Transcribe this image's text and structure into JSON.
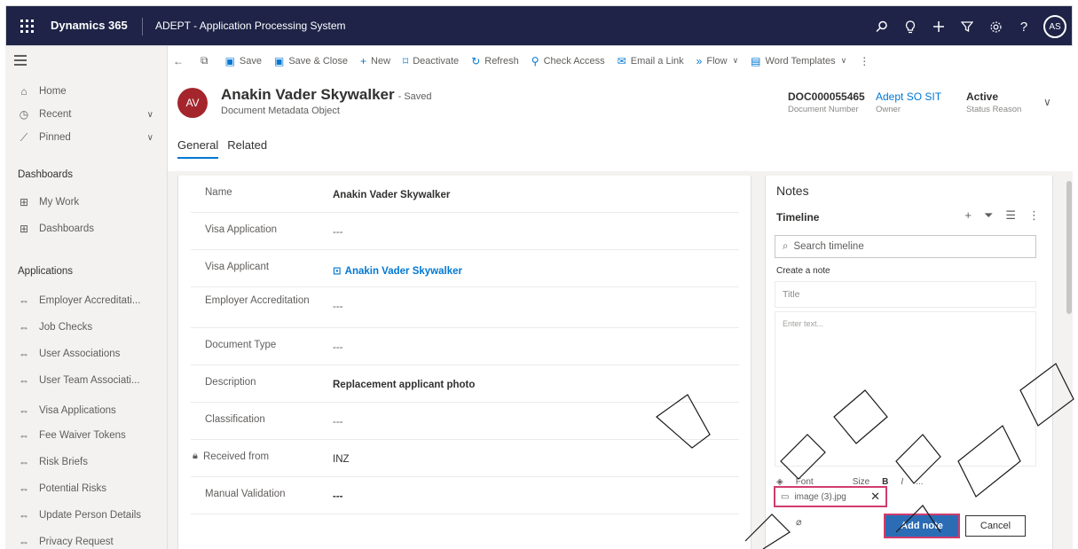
{
  "topbar": {
    "brand": "Dynamics 365",
    "app_name": "ADEPT - Application Processing System",
    "user_initials": "AS"
  },
  "sidebar": {
    "home": "Home",
    "recent": "Recent",
    "pinned": "Pinned",
    "dashboards_heading": "Dashboards",
    "my_work": "My Work",
    "dashboards": "Dashboards",
    "applications_heading": "Applications",
    "items": [
      "Employer Accreditati...",
      "Job Checks",
      "User Associations",
      "User Team Associati...",
      "Visa Applications",
      "Fee Waiver Tokens",
      "Risk Briefs",
      "Potential Risks",
      "Update Person Details",
      "Privacy Request"
    ]
  },
  "commands": {
    "save": "Save",
    "save_close": "Save & Close",
    "new": "New",
    "deactivate": "Deactivate",
    "refresh": "Refresh",
    "check_access": "Check Access",
    "email_link": "Email a Link",
    "flow": "Flow",
    "word_templates": "Word Templates"
  },
  "record": {
    "initials": "AV",
    "title": "Anakin Vader Skywalker",
    "saved": "- Saved",
    "entity": "Document Metadata Object",
    "doc_number": "DOC000055465",
    "doc_number_label": "Document Number",
    "owner": "Adept SO SIT",
    "owner_label": "Owner",
    "status": "Active",
    "status_label": "Status Reason"
  },
  "tabs": {
    "general": "General",
    "related": "Related"
  },
  "form": {
    "name_label": "Name",
    "name_value": "Anakin Vader Skywalker",
    "visa_app_label": "Visa Application",
    "visa_app_value": "---",
    "visa_applicant_label": "Visa Applicant",
    "visa_applicant_value": "Anakin Vader Skywalker",
    "employer_label": "Employer Accreditation",
    "employer_value": "---",
    "doc_type_label": "Document Type",
    "doc_type_value": "---",
    "description_label": "Description",
    "description_value": "Replacement applicant photo",
    "classification_label": "Classification",
    "classification_value": "---",
    "received_label": "Received from",
    "received_value": "INZ",
    "manual_label": "Manual Validation",
    "manual_value": "---"
  },
  "notes": {
    "title": "Notes",
    "timeline": "Timeline",
    "search_placeholder": "Search timeline",
    "create_note": "Create a note",
    "title_placeholder": "Title",
    "body_placeholder": "Enter text...",
    "font": "Font",
    "size": "Size",
    "bold": "B",
    "italic": "I",
    "more": "...",
    "attachment": "image (3).jpg",
    "add_note": "Add note",
    "cancel": "Cancel"
  },
  "colors": {
    "topbar": "#1e2347",
    "accent": "#0078d4",
    "record_avatar": "#a4262c",
    "highlight": "#d13c6e"
  }
}
